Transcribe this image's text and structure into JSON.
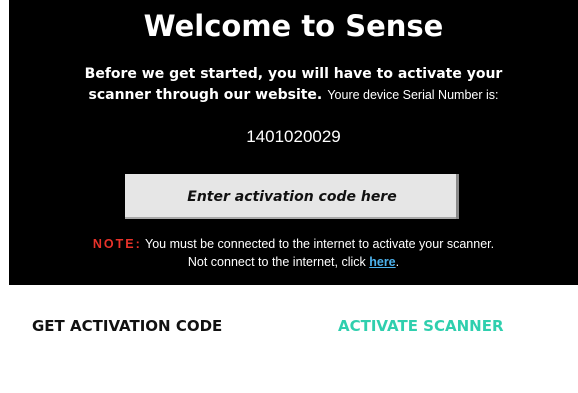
{
  "dialog": {
    "title": "Welcome to Sense",
    "intro_bold_line1": "Before we get started, you will have to activate your",
    "intro_bold_line2": "scanner through our website.",
    "intro_serial_label": "Youre device Serial Number is:",
    "serial_number": "1401020029",
    "activation_placeholder": "Enter activation code here",
    "note_label": "NOTE:",
    "note_text": "You must be connected to the internet to activate your scanner.",
    "offline_text": "Not connect to the internet, click",
    "offline_link": "here",
    "offline_suffix": "."
  },
  "actions": {
    "get_code_label": "GET ACTIVATION CODE",
    "activate_label": "ACTIVATE SCANNER"
  },
  "colors": {
    "panel_bg": "#000000",
    "note_red": "#e8322a",
    "link_blue": "#4db2ec",
    "activate_teal": "#2fcfae"
  }
}
